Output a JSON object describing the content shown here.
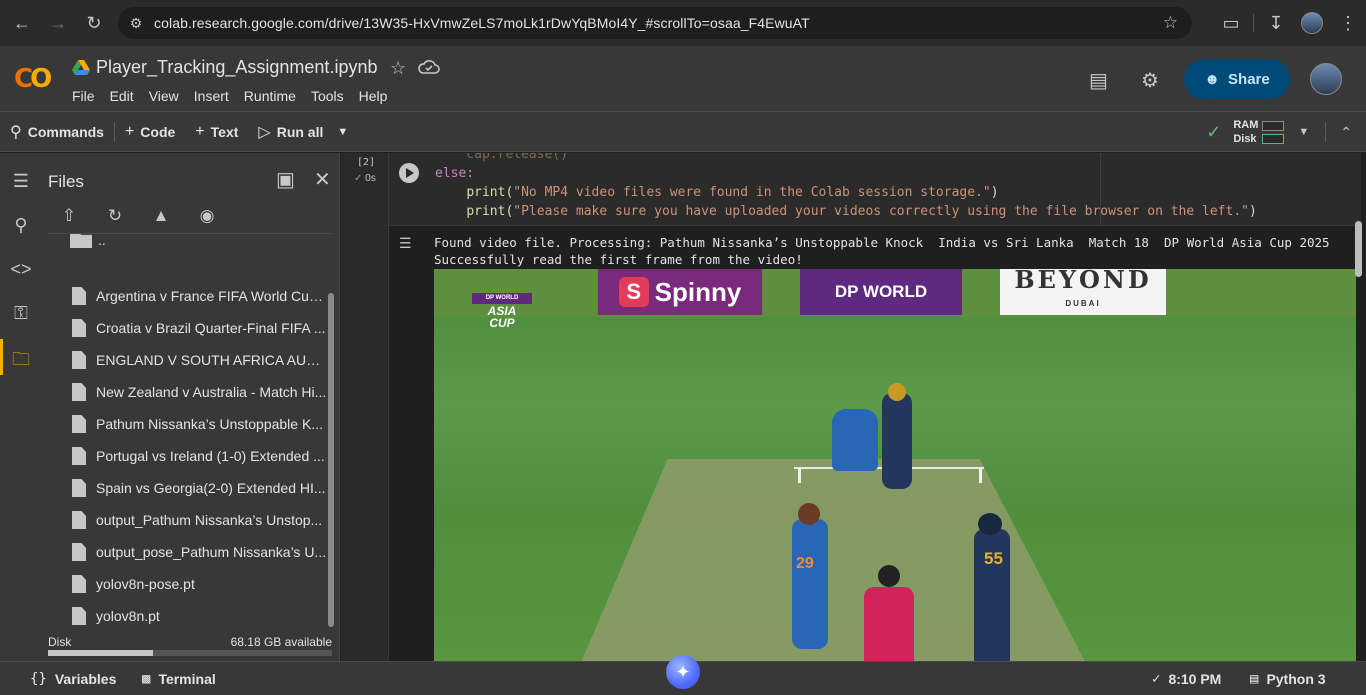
{
  "browser": {
    "url": "colab.research.google.com/drive/13W35-HxVmwZeLS7moLk1rDwYqBMoI4Y_#scrollTo=osaa_F4EwuAT"
  },
  "header": {
    "notebook_title": "Player_Tracking_Assignment.ipynb",
    "menu": [
      "File",
      "Edit",
      "View",
      "Insert",
      "Runtime",
      "Tools",
      "Help"
    ],
    "share_label": "Share"
  },
  "toolbar": {
    "commands_label": "Commands",
    "code_label": "Code",
    "text_label": "Text",
    "run_all_label": "Run all",
    "ram_label": "RAM",
    "disk_label": "Disk"
  },
  "files_panel": {
    "title": "Files",
    "parent_folder": "..",
    "items": [
      "Argentina v France FIFA World Cup...",
      "Croatia v Brazil Quarter-Final FIFA ...",
      "ENGLAND V SOUTH AFRICA AUTU...",
      "New Zealand v Australia - Match Hi...",
      "Pathum Nissanka’s Unstoppable K...",
      "Portugal vs Ireland (1-0) Extended ...",
      "Spain vs Georgia(2-0) Extended HI...",
      "output_Pathum Nissanka’s Unstop...",
      "output_pose_Pathum Nissanka’s U...",
      "yolov8n-pose.pt",
      "yolov8n.pt"
    ],
    "disk_label": "Disk",
    "disk_available": "68.18 GB available",
    "disk_used_fraction": 0.37
  },
  "cell": {
    "execution_count": "[2]",
    "exec_time": "0s",
    "code_lines": {
      "line0": "cap.release()",
      "line1": "else:",
      "line2_fn": "print(",
      "line2_str": "\"No MP4 video files were found in the Colab session storage.\"",
      "line2_end": ")",
      "line3_fn": "print(",
      "line3_str": "\"Please make sure you have uploaded your videos correctly using the file browser on the left.\"",
      "line3_end": ")"
    },
    "output_line1": "Found video file. Processing: Pathum Nissanka’s Unstoppable Knock  India vs Sri Lanka  Match 18  DP World Asia Cup 2025",
    "output_line2": "Successfully read the first frame from the video!"
  },
  "frame": {
    "ad_spinny": "Spinny",
    "ad_dpworld": "DP WORLD",
    "ad_beyond": "BEYOND",
    "ad_beyond_sub": "DUBAI",
    "logo_tag": "DP WORLD",
    "logo_line1": "ASIA",
    "logo_line2": "CUP",
    "bowler_number": "29",
    "nonstriker_number": "55"
  },
  "statusbar": {
    "variables_label": "Variables",
    "terminal_label": "Terminal",
    "time": "8:10 PM",
    "runtime": "Python 3"
  }
}
